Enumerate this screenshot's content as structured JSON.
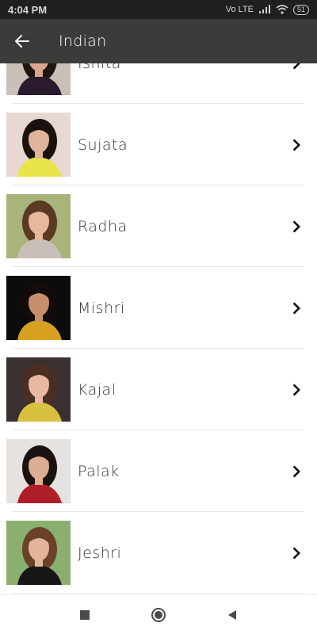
{
  "status_bar": {
    "time": "4:04 PM",
    "network": "Vo LTE",
    "battery": "51"
  },
  "toolbar": {
    "title": "Indian"
  },
  "list": {
    "items": [
      {
        "name": "Ishita",
        "photo": {
          "bg": "#c9c0b8",
          "hair": "#1e1410",
          "skin": "#d9a58c",
          "outfit": "#2b1a2e"
        }
      },
      {
        "name": "Sujata",
        "photo": {
          "bg": "#e8d8d4",
          "hair": "#1a120e",
          "skin": "#e0b39a",
          "outfit": "#e8e44a"
        }
      },
      {
        "name": "Radha",
        "photo": {
          "bg": "#a8b47a",
          "hair": "#5a3a22",
          "skin": "#e8b89c",
          "outfit": "#c8c0b8"
        }
      },
      {
        "name": "Mishri",
        "photo": {
          "bg": "#0c0c0c",
          "hair": "#120c0a",
          "skin": "#c98e6c",
          "outfit": "#d8a020"
        }
      },
      {
        "name": "Kajal",
        "photo": {
          "bg": "#3a3030",
          "hair": "#4a2e22",
          "skin": "#e8b8a0",
          "outfit": "#d8c040"
        }
      },
      {
        "name": "Palak",
        "photo": {
          "bg": "#e6e2e0",
          "hair": "#1a120e",
          "skin": "#dcae92",
          "outfit": "#b01e2a"
        }
      },
      {
        "name": "Jeshri",
        "photo": {
          "bg": "#8ab070",
          "hair": "#6a4228",
          "skin": "#e2b49a",
          "outfit": "#161616"
        }
      }
    ]
  }
}
